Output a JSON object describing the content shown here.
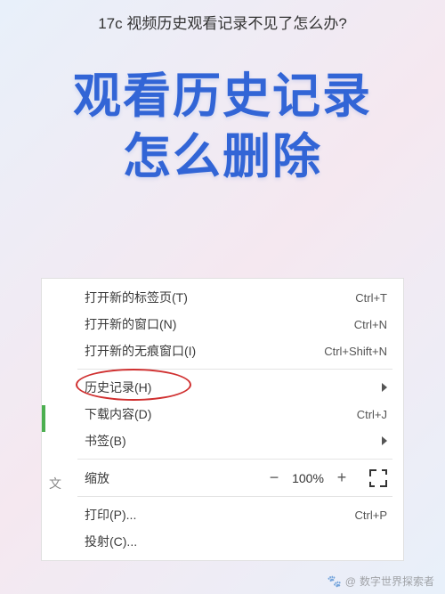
{
  "page_title": "17c 视频历史观看记录不见了怎么办?",
  "headline": {
    "line1": "观看历史记录",
    "line2": "怎么删除"
  },
  "menu": {
    "new_tab": {
      "label": "打开新的标签页(T)",
      "shortcut": "Ctrl+T"
    },
    "new_window": {
      "label": "打开新的窗口(N)",
      "shortcut": "Ctrl+N"
    },
    "incognito": {
      "label": "打开新的无痕窗口(I)",
      "shortcut": "Ctrl+Shift+N"
    },
    "history": {
      "label": "历史记录(H)"
    },
    "downloads": {
      "label": "下载内容(D)",
      "shortcut": "Ctrl+J"
    },
    "bookmarks": {
      "label": "书签(B)"
    },
    "zoom": {
      "label": "缩放",
      "minus": "−",
      "value": "100%",
      "plus": "+"
    },
    "print": {
      "label": "打印(P)...",
      "shortcut": "Ctrl+P"
    },
    "cast": {
      "label": "投射(C)..."
    }
  },
  "side_char": "文",
  "attribution": {
    "prefix": "@",
    "name": "数字世界探索者"
  }
}
